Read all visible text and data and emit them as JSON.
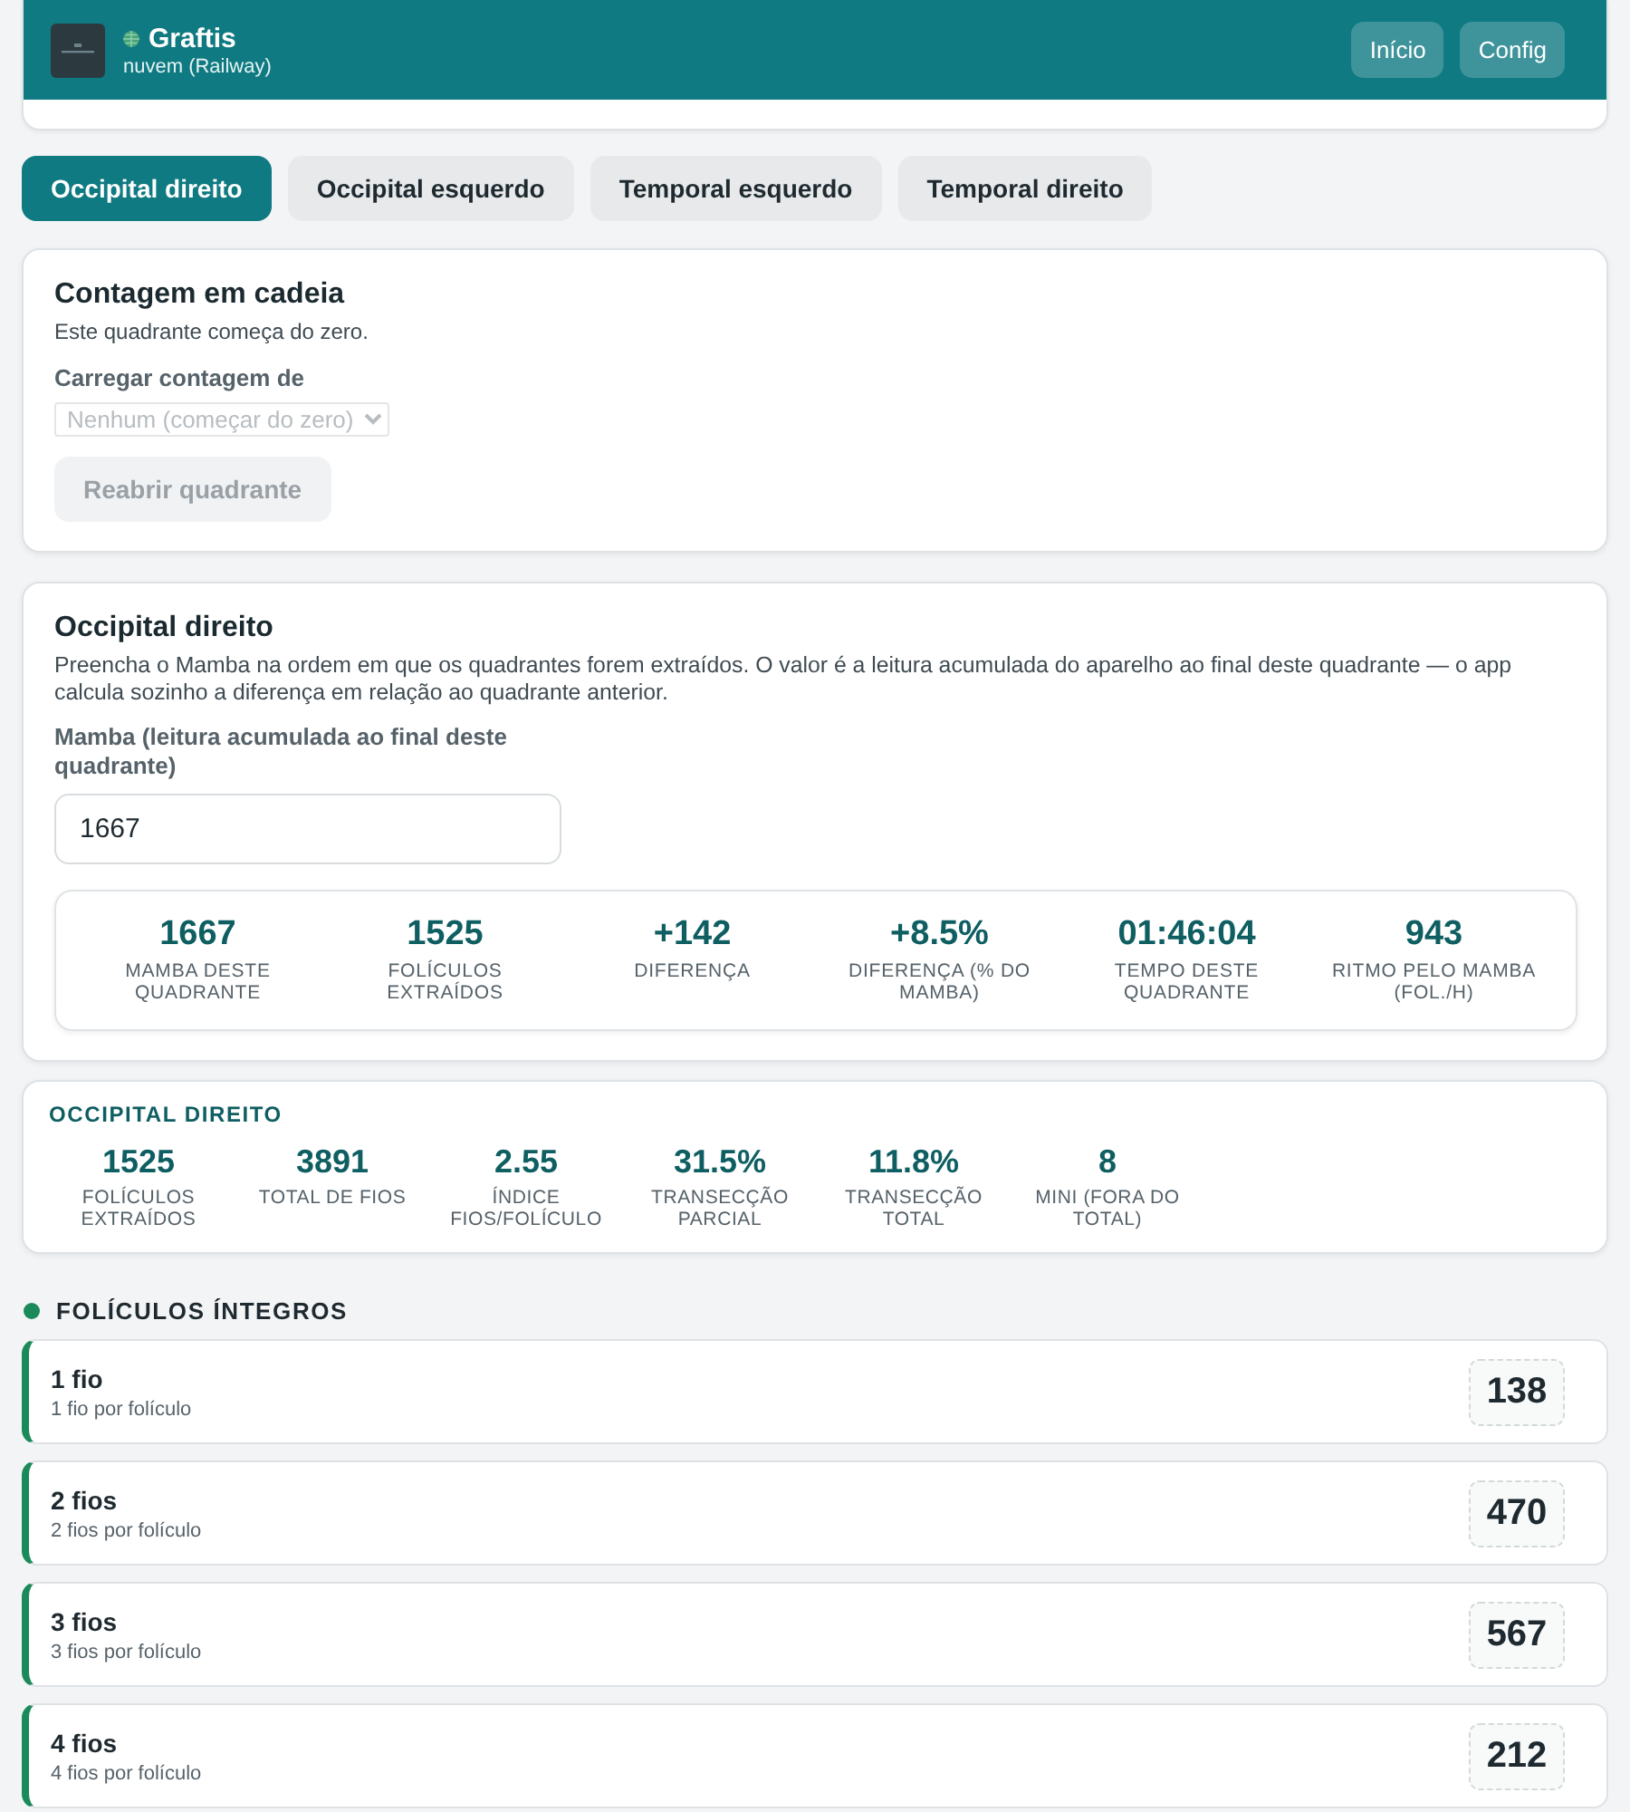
{
  "header": {
    "title": "Graftis",
    "subtitle": "nuvem (Railway)",
    "nav": [
      {
        "label": "Início"
      },
      {
        "label": "Config"
      }
    ]
  },
  "tabs": [
    {
      "label": "Occipital direito",
      "selected": true
    },
    {
      "label": "Occipital esquerdo",
      "selected": false
    },
    {
      "label": "Temporal esquerdo",
      "selected": false
    },
    {
      "label": "Temporal direito",
      "selected": false
    }
  ],
  "chain_card": {
    "title": "Contagem em cadeia",
    "note": "Este quadrante começa do zero.",
    "select": {
      "label": "Carregar contagem de",
      "value": "Nenhum (começar do zero)",
      "disabled": true
    },
    "reopen_button": {
      "label": "Reabrir quadrante",
      "disabled": true
    }
  },
  "quadrant_card": {
    "title": "Occipital direito",
    "description": "Preencha o Mamba na ordem em que os quadrantes forem extraídos. O valor é a leitura acumulada do aparelho ao final deste quadrante — o app calcula sozinho a diferença em relação ao quadrante anterior.",
    "field": {
      "label": "Mamba (leitura acumulada ao final deste quadrante)",
      "value": "1667"
    },
    "stats": [
      {
        "value": "1667",
        "label": "MAMBA DESTE QUADRANTE"
      },
      {
        "value": "1525",
        "label": "FOLÍCULOS EXTRAÍDOS"
      },
      {
        "value": "+142",
        "label": "DIFERENÇA"
      },
      {
        "value": "+8.5%",
        "label": "DIFERENÇA (% DO MAMBA)"
      },
      {
        "value": "01:46:04",
        "label": "TEMPO DESTE QUADRANTE"
      },
      {
        "value": "943",
        "label": "RITMO PELO MAMBA (FOL./H)"
      }
    ]
  },
  "summary": {
    "title": "OCCIPITAL DIREITO",
    "stats": [
      {
        "value": "1525",
        "label": "FOLÍCULOS EXTRAÍDOS"
      },
      {
        "value": "3891",
        "label": "TOTAL DE FIOS"
      },
      {
        "value": "2.55",
        "label": "ÍNDICE FIOS/FOLÍCULO"
      },
      {
        "value": "31.5%",
        "label": "TRANSECÇÃO PARCIAL"
      },
      {
        "value": "11.8%",
        "label": "TRANSECÇÃO TOTAL"
      },
      {
        "value": "8",
        "label": "MINI (FORA DO TOTAL)"
      }
    ]
  },
  "sections": [
    {
      "title": "FOLÍCULOS ÍNTEGROS",
      "color": "#1b8a5a",
      "rows": [
        {
          "title": "1 fio",
          "subtitle": "1 fio por folículo",
          "count": "138"
        },
        {
          "title": "2 fios",
          "subtitle": "2 fios por folículo",
          "count": "470"
        },
        {
          "title": "3 fios",
          "subtitle": "3 fios por folículo",
          "count": "567"
        },
        {
          "title": "4 fios",
          "subtitle": "4 fios por folículo",
          "count": "212"
        }
      ]
    }
  ]
}
